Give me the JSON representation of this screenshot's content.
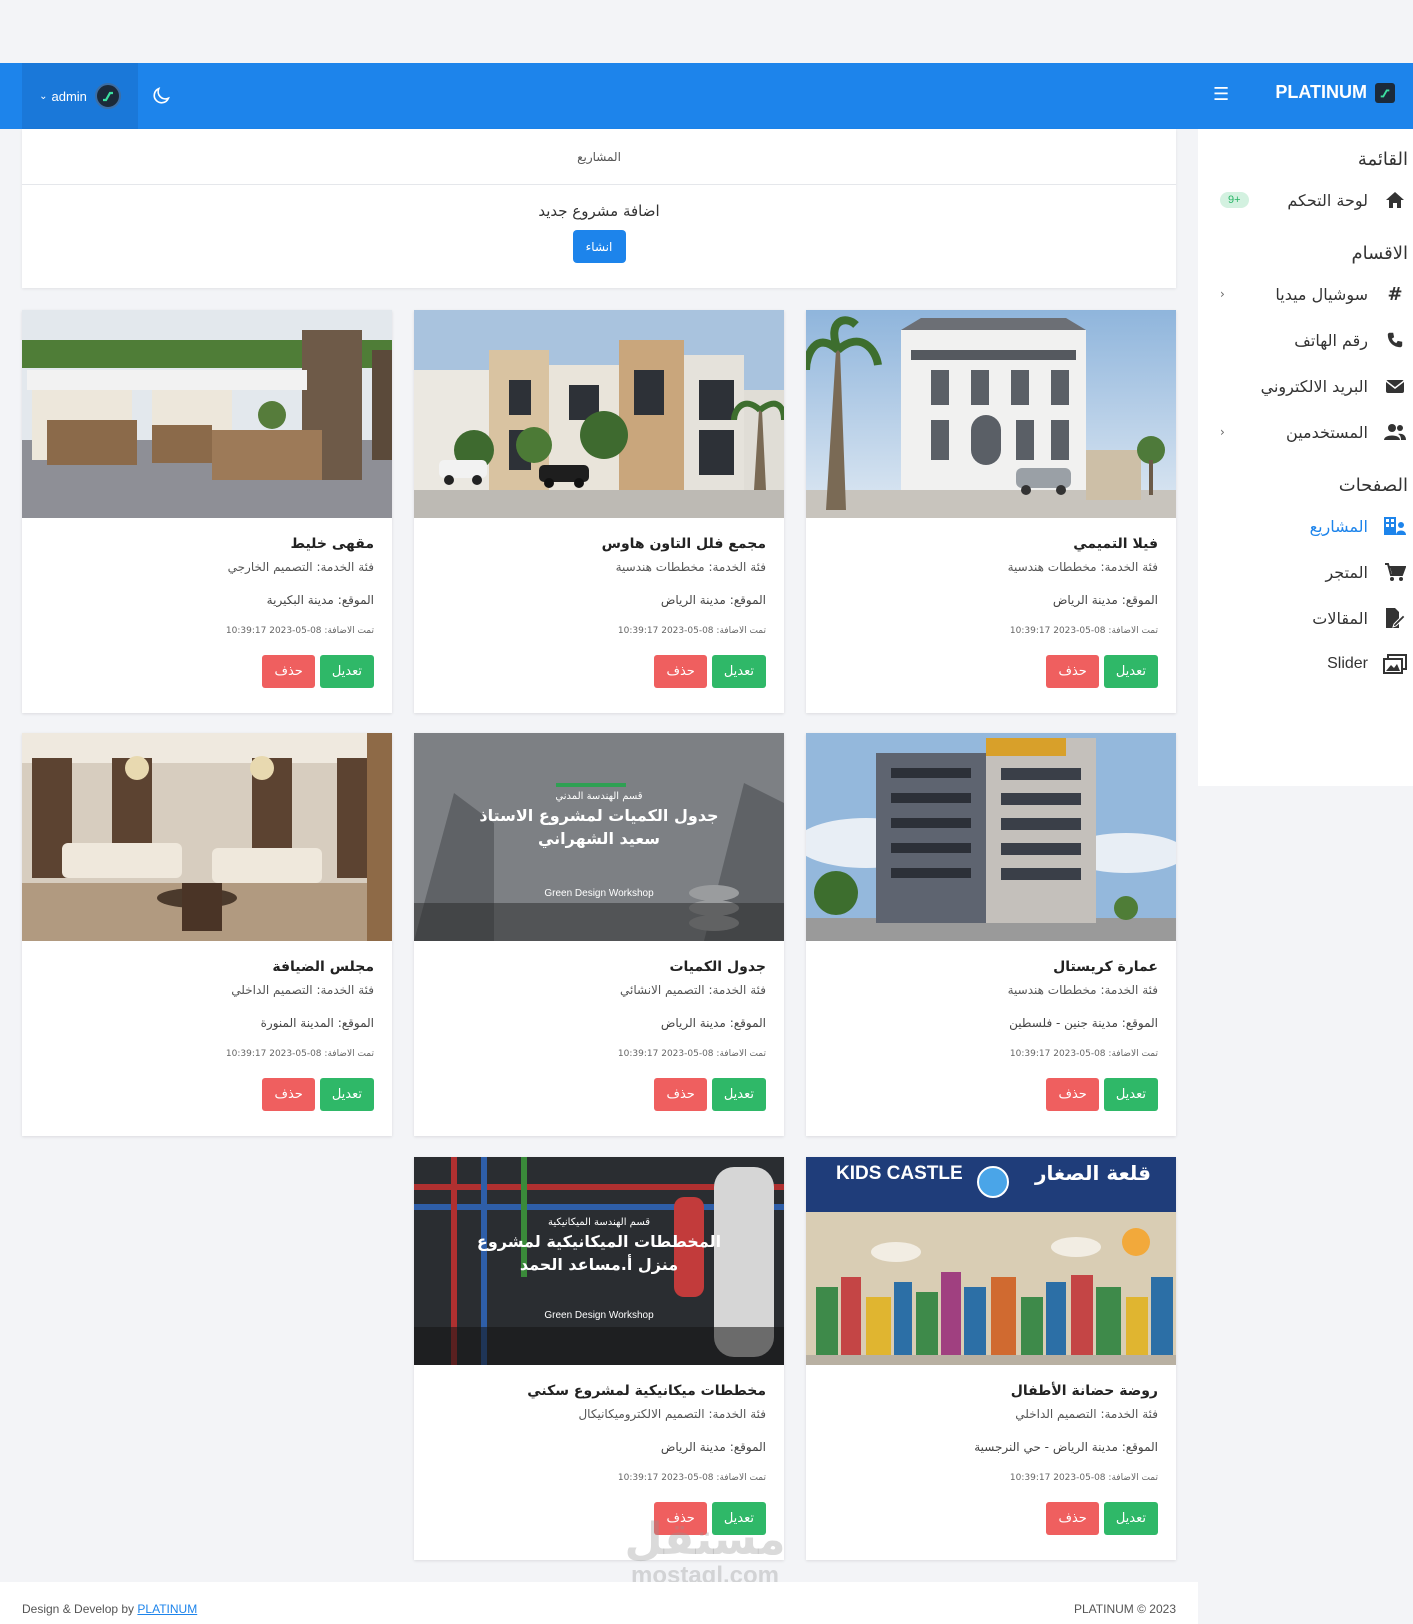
{
  "topbar": {
    "user": "admin",
    "brand": "PLATINUM"
  },
  "sidebar": {
    "menu_heading": "القائمة",
    "dashboard": "لوحة التحكم",
    "dashboard_badge": "+9",
    "sections_heading": "الاقسام",
    "social": "سوشيال ميديا",
    "phone": "رقم الهاتف",
    "email": "البريد الالكتروني",
    "users": "المستخدمين",
    "pages_heading": "الصفحات",
    "projects": "المشاريع",
    "store": "المتجر",
    "articles": "المقالات",
    "slider": "Slider"
  },
  "header": {
    "breadcrumb": "المشاريع",
    "add_title": "اضافة مشروع جديد",
    "create_label": "انشاء"
  },
  "labels": {
    "service_prefix": "فئة الخدمة:",
    "location_prefix": "الموقع:",
    "added_prefix": "تمت الاضافة:",
    "edit": "تعديل",
    "delete": "حذف"
  },
  "projects": [
    {
      "title": "فيلا التميمي",
      "service": "مخططات هندسية",
      "location": "مدينة الرياض",
      "date": "08-05-2023 10:39:17"
    },
    {
      "title": "مجمع فلل التاون هاوس",
      "service": "مخططات هندسية",
      "location": "مدينة الرياض",
      "date": "08-05-2023 10:39:17"
    },
    {
      "title": "مقهى خليط",
      "service": "التصميم الخارجي",
      "location": "مدينة البكيرية",
      "date": "08-05-2023 10:39:17"
    },
    {
      "title": "عمارة كريستال",
      "service": "مخططات هندسية",
      "location": "مدينة جنين - فلسطين",
      "date": "08-05-2023 10:39:17"
    },
    {
      "title": "جدول الكميات",
      "service": "التصميم الانشائي",
      "location": "مدينة الرياض",
      "date": "08-05-2023 10:39:17"
    },
    {
      "title": "مجلس الضيافة",
      "service": "التصميم الداخلي",
      "location": "المدينة المنورة",
      "date": "08-05-2023 10:39:17"
    },
    {
      "title": "روضة حضانة الأطفال",
      "service": "التصميم الداخلي",
      "location": "مدينة الرياض - حي النرجسية",
      "date": "08-05-2023 10:39:17"
    },
    {
      "title": "مخططات ميكانيكية لمشروع سكني",
      "service": "التصميم الالكتروميكانيكال",
      "location": "مدينة الرياض",
      "date": "08-05-2023 10:39:17"
    }
  ],
  "images": {
    "p5_line1": "قسم الهندسة المدني",
    "p5_line2": "جدول الكميات لمشروع الاستاذ",
    "p5_line3": "سعيد الشهراني",
    "p5_line4": "Green Design Workshop",
    "p7_en": "KIDS CASTLE",
    "p7_ar": "قلعة الصغار",
    "p8_line1": "قسم الهندسة الميكانيكية",
    "p8_line2": "المخططات الميكانيكية لمشروع",
    "p8_line3": "منزل أ.مساعد الحمد",
    "p8_line4": "Green Design Workshop"
  },
  "footer": {
    "left_prefix": "Design & Develop by",
    "left_link": "PLATINUM",
    "right": "PLATINUM © 2023"
  },
  "watermark": {
    "ar": "مستقل",
    "en": "mostaql.com"
  },
  "colors": {
    "primary": "#1d84eb",
    "edit": "#2fb868",
    "delete": "#ef5f5f"
  }
}
